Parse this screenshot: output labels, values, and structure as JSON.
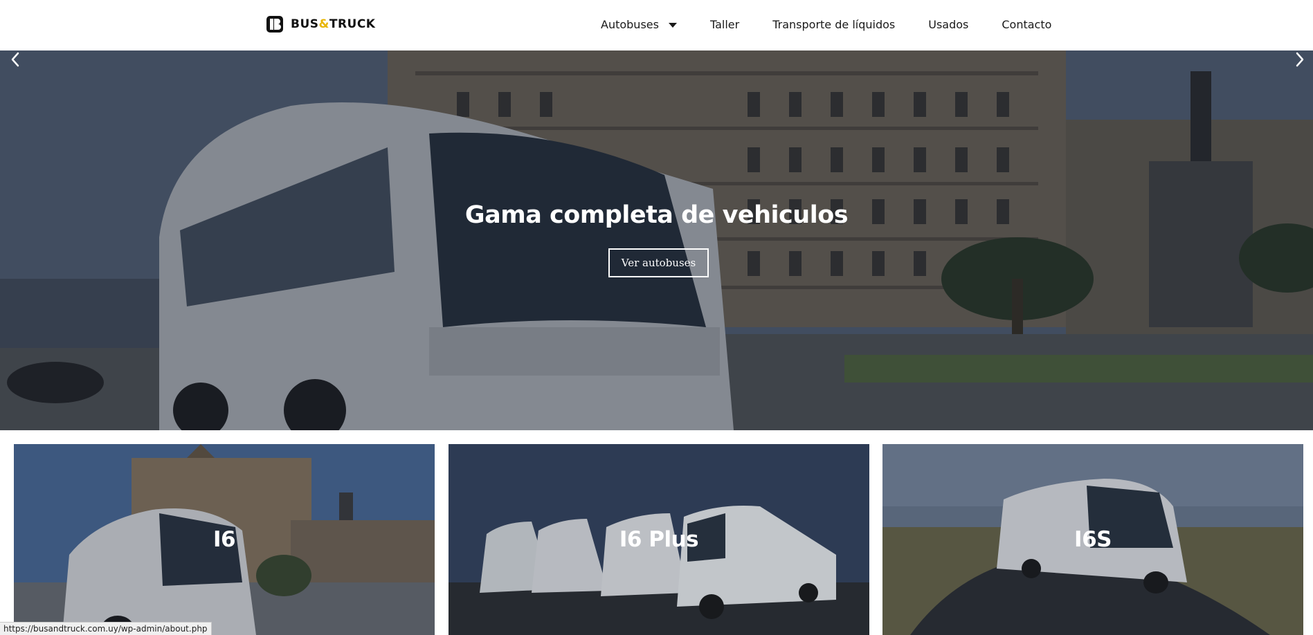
{
  "header": {
    "logo": {
      "text_main": "BUS",
      "text_amp": "&",
      "text_end": "TRUCK"
    },
    "nav": [
      {
        "label": "Autobuses",
        "has_dropdown": true
      },
      {
        "label": "Taller"
      },
      {
        "label": "Transporte de líquidos"
      },
      {
        "label": "Usados"
      },
      {
        "label": "Contacto"
      }
    ]
  },
  "hero": {
    "title": "Gama completa de vehiculos",
    "button_label": "Ver autobuses",
    "prev_icon": "chevron-left-icon",
    "next_icon": "chevron-right-icon"
  },
  "cards": [
    {
      "title": "I6"
    },
    {
      "title": "I6 Plus"
    },
    {
      "title": "I6S"
    }
  ],
  "statusbar": {
    "url": "https://busandtruck.com.uy/wp-admin/about.php"
  },
  "colors": {
    "accent": "#e8b500",
    "text": "#1a1a1a",
    "overlay": "#141c2d"
  }
}
